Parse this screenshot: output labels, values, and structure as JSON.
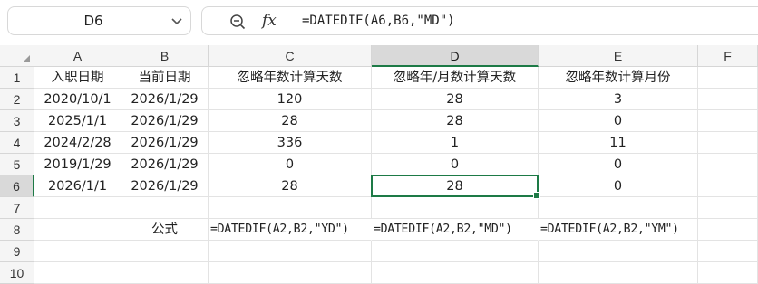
{
  "name_box": {
    "cell_ref": "D6",
    "dropdown_icon": "chevron-down-icon"
  },
  "formula_bar": {
    "zoom_icon": "zoom-icon",
    "fx_label": "fx",
    "formula": "=DATEDIF(A6,B6,\"MD\")"
  },
  "columns": [
    "A",
    "B",
    "C",
    "D",
    "E",
    "F"
  ],
  "active_column": "D",
  "rows": [
    "1",
    "2",
    "3",
    "4",
    "5",
    "6",
    "7",
    "8",
    "9",
    "10"
  ],
  "active_row": "6",
  "cells": {
    "A1": "入职日期",
    "B1": "当前日期",
    "C1": "忽略年数计算天数",
    "D1": "忽略年/月数计算天数",
    "E1": "忽略年数计算月份",
    "A2": "2020/10/1",
    "B2": "2026/1/29",
    "C2": "120",
    "D2": "28",
    "E2": "3",
    "A3": "2025/1/1",
    "B3": "2026/1/29",
    "C3": "28",
    "D3": "28",
    "E3": "0",
    "A4": "2024/2/28",
    "B4": "2026/1/29",
    "C4": "336",
    "D4": "1",
    "E4": "11",
    "A5": "2019/1/29",
    "B5": "2026/1/29",
    "C5": "0",
    "D5": "0",
    "E5": "0",
    "A6": "2026/1/1",
    "B6": "2026/1/29",
    "C6": "28",
    "D6": "28",
    "E6": "0",
    "B8": "公式",
    "C8": "=DATEDIF(A2,B2,\"YD\")",
    "D8": "=DATEDIF(A2,B2,\"MD\")",
    "E8": "=DATEDIF(A2,B2,\"YM\")"
  },
  "colors": {
    "accent": "#1d7a46",
    "header_bg": "#f5f5f5",
    "active_header_bg": "#d9d9d9"
  }
}
